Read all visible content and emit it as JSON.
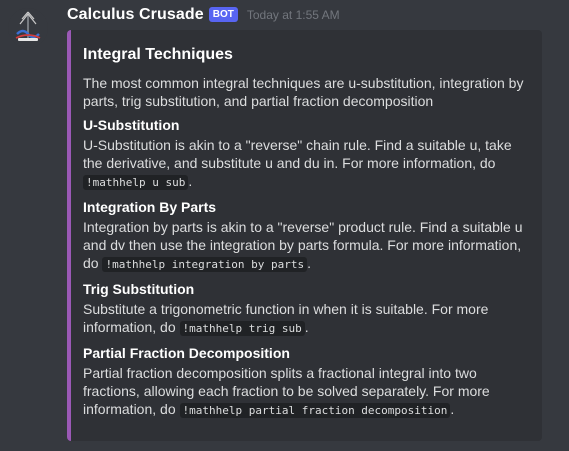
{
  "author": {
    "name": "Calculus Crusade",
    "tag": "BOT",
    "timestamp": "Today at 1:55 AM",
    "avatar_icon": "calculus-crusade-logo"
  },
  "colors": {
    "background": "#36393f",
    "embed_background": "#2f3136",
    "embed_accent": "#9b59b6",
    "bot_tag": "#5865f2"
  },
  "embed": {
    "title": "Integral Techniques",
    "description": "The most common integral techniques are u-substitution, integration by parts, trig substitution, and partial fraction decomposition",
    "fields": [
      {
        "name": "U-Substitution",
        "text": "U-Substitution is akin to a \"reverse\" chain rule. Find a suitable u, take the derivative, and substitute u and du in. For more information, do ",
        "command": "!mathhelp u sub",
        "suffix": "."
      },
      {
        "name": "Integration By Parts",
        "text": "Integration by parts is akin to a \"reverse\" product rule. Find a suitable u and dv then use the integration by parts formula. For more information, do ",
        "command": "!mathhelp integration by parts",
        "suffix": "."
      },
      {
        "name": "Trig Substitution",
        "text": "Substitute a trigonometric function in when it is suitable. For more information, do ",
        "command": "!mathhelp trig sub",
        "suffix": "."
      },
      {
        "name": "Partial Fraction Decomposition",
        "text": "Partial fraction decomposition splits a fractional integral into two fractions, allowing each fraction to be solved separately. For more information, do ",
        "command": "!mathhelp partial fraction decomposition",
        "suffix": "."
      }
    ]
  }
}
